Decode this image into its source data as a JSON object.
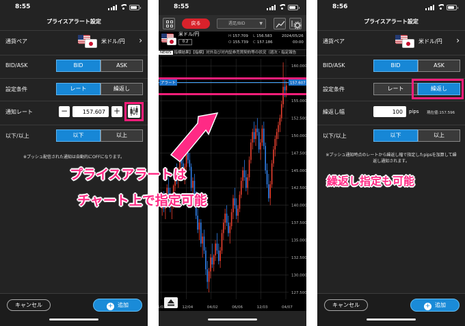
{
  "screens": {
    "left": {
      "status_time": "8:55",
      "title": "プライスアラート設定",
      "currency_pair_label": "通貨ペア",
      "currency_pair_value": "米ドル/円",
      "bidask_label": "BID/ASK",
      "bid": "BID",
      "ask": "ASK",
      "condition_label": "設定条件",
      "cond_rate": "レート",
      "cond_repeat": "繰返し",
      "notify_rate_label": "通知レート",
      "notify_rate_value": "157.607",
      "minus": "−",
      "plus": "+",
      "direction_label": "以下/以上",
      "below": "以下",
      "above": "以上",
      "notice": "※プッシュ配信された通知は自動的にOFFになります。",
      "cancel": "キャンセル",
      "add": "追加"
    },
    "center": {
      "status_time": "8:55",
      "back": "戻る",
      "dropdown": "週足/BID",
      "pair": "米ドル/円",
      "pip_box": "0.2",
      "quotes": {
        "H": "157.709",
        "L": "156.583",
        "O": "155.739",
        "C": "157.186"
      },
      "date": "2024/05/26",
      "time": "00:00",
      "news_tag": "NEWS",
      "news_text": "指標結果】【指標】対外及び対内証券売買契約等の状況（週次・指定報告",
      "alert_tag": "アラート",
      "alert_price": "157.607",
      "x_labels": [
        "6/01",
        "12/04",
        "04/02",
        "06/06",
        "12/03",
        "04/07"
      ]
    },
    "right": {
      "status_time": "8:56",
      "title": "プライスアラート設定",
      "currency_pair_label": "通貨ペア",
      "currency_pair_value": "米ドル/円",
      "bidask_label": "BID/ASK",
      "bid": "BID",
      "ask": "ASK",
      "condition_label": "設定条件",
      "cond_rate": "レート",
      "cond_repeat": "繰返し",
      "repeat_width_label": "繰返し幅",
      "repeat_width_value": "100",
      "pips": "pips",
      "current_value": "現在値:157.596",
      "direction_label": "以下/以上",
      "below": "以下",
      "above": "以上",
      "notice": "※プッシュ通知時点のレートから繰返し幅で指定したpipsを加算して繰返し通知されます。",
      "cancel": "キャンセル",
      "add": "追加"
    }
  },
  "captions": {
    "chart_line1": "プライスアラートは",
    "chart_line2": "チャート上で指定可能",
    "repeat": "繰返し指定も可能"
  },
  "chart_data": {
    "type": "candlestick",
    "y_ticks": [
      160.0,
      157.5,
      155.0,
      152.5,
      150.0,
      147.5,
      145.0,
      142.5,
      140.0,
      137.5,
      135.0,
      132.5,
      130.0,
      127.5
    ],
    "ylim": [
      126.5,
      161.0
    ],
    "alert_level": 157.607,
    "candles": [
      [
        139.5,
        141.0,
        138.5,
        140.5
      ],
      [
        140.5,
        142.0,
        139.0,
        139.5
      ],
      [
        139.5,
        141.5,
        138.0,
        141.0
      ],
      [
        141.0,
        143.0,
        140.0,
        142.5
      ],
      [
        142.5,
        144.0,
        141.0,
        141.5
      ],
      [
        141.5,
        142.5,
        139.0,
        139.8
      ],
      [
        139.8,
        141.0,
        138.0,
        140.5
      ],
      [
        140.5,
        143.0,
        139.5,
        142.8
      ],
      [
        142.8,
        145.0,
        142.0,
        144.5
      ],
      [
        144.5,
        146.0,
        143.0,
        143.5
      ],
      [
        143.5,
        145.5,
        142.5,
        145.0
      ],
      [
        145.0,
        147.5,
        144.0,
        147.0
      ],
      [
        147.0,
        148.0,
        145.5,
        146.0
      ],
      [
        146.0,
        147.0,
        144.0,
        144.5
      ],
      [
        144.5,
        146.0,
        143.0,
        145.5
      ],
      [
        145.5,
        148.0,
        145.0,
        147.5
      ],
      [
        147.5,
        149.0,
        146.0,
        146.5
      ],
      [
        146.5,
        147.5,
        145.0,
        145.5
      ],
      [
        145.5,
        146.0,
        142.0,
        142.5
      ],
      [
        142.5,
        144.0,
        141.0,
        143.5
      ],
      [
        143.5,
        144.5,
        140.5,
        141.0
      ],
      [
        141.0,
        142.0,
        138.0,
        138.5
      ],
      [
        138.5,
        139.5,
        136.0,
        136.5
      ],
      [
        136.5,
        138.0,
        135.0,
        137.5
      ],
      [
        137.5,
        138.0,
        134.0,
        134.5
      ],
      [
        134.5,
        136.0,
        132.5,
        135.5
      ],
      [
        135.5,
        136.5,
        133.0,
        133.5
      ],
      [
        133.5,
        134.0,
        130.0,
        130.8
      ],
      [
        130.8,
        132.0,
        128.0,
        129.0
      ],
      [
        129.0,
        131.0,
        127.5,
        130.5
      ],
      [
        130.5,
        133.0,
        129.5,
        132.5
      ],
      [
        132.5,
        134.5,
        131.0,
        131.5
      ],
      [
        131.5,
        133.0,
        130.5,
        132.8
      ],
      [
        132.8,
        135.0,
        132.0,
        134.5
      ],
      [
        134.5,
        136.0,
        133.0,
        133.5
      ],
      [
        133.5,
        134.5,
        131.5,
        132.0
      ],
      [
        132.0,
        134.0,
        131.0,
        133.5
      ],
      [
        133.5,
        136.5,
        133.0,
        136.0
      ],
      [
        136.0,
        138.0,
        135.0,
        137.5
      ],
      [
        137.5,
        139.5,
        136.5,
        138.8
      ],
      [
        138.8,
        140.0,
        137.0,
        137.5
      ],
      [
        137.5,
        138.5,
        135.5,
        136.0
      ],
      [
        136.0,
        137.5,
        134.5,
        137.0
      ],
      [
        137.0,
        139.5,
        136.5,
        139.0
      ],
      [
        139.0,
        141.5,
        138.0,
        141.0
      ],
      [
        141.0,
        142.5,
        139.5,
        140.0
      ],
      [
        140.0,
        141.0,
        138.0,
        138.5
      ],
      [
        138.5,
        140.0,
        137.5,
        139.5
      ],
      [
        139.5,
        142.0,
        139.0,
        141.5
      ],
      [
        141.5,
        144.0,
        141.0,
        143.5
      ],
      [
        143.5,
        145.5,
        142.5,
        145.0
      ],
      [
        145.0,
        146.5,
        143.5,
        144.0
      ],
      [
        144.0,
        145.0,
        142.0,
        142.5
      ],
      [
        142.5,
        144.5,
        141.5,
        144.0
      ],
      [
        144.0,
        147.0,
        143.5,
        146.5
      ],
      [
        146.5,
        149.5,
        146.0,
        149.0
      ],
      [
        149.0,
        151.0,
        148.0,
        150.5
      ],
      [
        150.5,
        152.0,
        149.0,
        149.5
      ],
      [
        149.5,
        151.5,
        148.5,
        151.0
      ],
      [
        151.0,
        152.5,
        150.0,
        150.5
      ],
      [
        150.5,
        151.0,
        147.5,
        148.0
      ],
      [
        148.0,
        149.5,
        146.5,
        149.0
      ],
      [
        149.0,
        151.5,
        148.5,
        151.0
      ],
      [
        151.0,
        152.0,
        148.0,
        148.5
      ],
      [
        148.5,
        149.0,
        144.5,
        145.0
      ],
      [
        145.0,
        146.0,
        142.5,
        143.0
      ],
      [
        143.0,
        144.5,
        140.5,
        141.0
      ],
      [
        141.0,
        143.5,
        140.0,
        143.0
      ],
      [
        143.0,
        146.5,
        142.5,
        146.0
      ],
      [
        146.0,
        148.5,
        145.5,
        148.0
      ],
      [
        148.0,
        150.0,
        147.0,
        149.5
      ],
      [
        149.5,
        151.0,
        148.5,
        150.5
      ],
      [
        150.5,
        152.0,
        149.5,
        151.5
      ],
      [
        151.5,
        153.0,
        150.5,
        152.5
      ],
      [
        152.5,
        155.0,
        152.0,
        154.5
      ],
      [
        154.5,
        160.5,
        154.0,
        157.0
      ],
      [
        157.0,
        158.0,
        155.5,
        156.5
      ],
      [
        156.5,
        157.8,
        155.5,
        157.2
      ]
    ]
  }
}
